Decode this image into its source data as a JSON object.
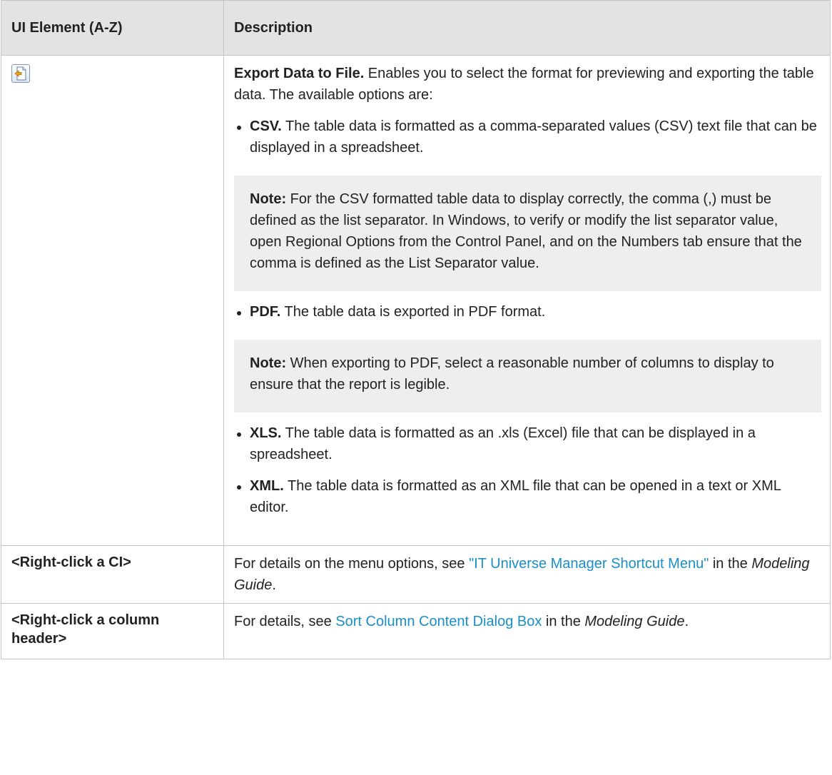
{
  "table": {
    "headers": {
      "element": "UI Element (A-Z)",
      "description": "Description"
    },
    "rows": {
      "export": {
        "icon": "export-data-icon",
        "title": "Export Data to File.",
        "intro": " Enables you to select the format for previewing and exporting the table data. The available options are:",
        "options": {
          "csv": {
            "label": "CSV.",
            "text": " The table data is formatted as a comma-separated values (CSV) text file that can be displayed in a spreadsheet.",
            "note_label": "Note:",
            "note_text": " For the CSV formatted table data to display correctly, the comma (,) must be defined as the list separator. In Windows, to verify or modify the list separator value, open Regional Options from the Control Panel, and on the Numbers tab ensure that the comma is defined as the List Separator value."
          },
          "pdf": {
            "label": "PDF.",
            "text": " The table data is exported in PDF format.",
            "note_label": "Note:",
            "note_text": " When exporting to PDF, select a reasonable number of columns to display to ensure that the report is legible."
          },
          "xls": {
            "label": "XLS.",
            "text": " The table data is formatted as an .xls (Excel) file that can be displayed in a spreadsheet."
          },
          "xml": {
            "label": "XML.",
            "text": " The table data is formatted as an XML file that can be opened in a text or XML editor."
          }
        }
      },
      "right_click_ci": {
        "element": "<Right-click a CI>",
        "desc_prefix": "For details on the menu options, see ",
        "link": "\"IT Universe Manager Shortcut Menu\"",
        "desc_mid": " in the ",
        "guide": "Modeling Guide",
        "desc_suffix": "."
      },
      "right_click_column": {
        "element": "<Right-click a column header>",
        "desc_prefix": "For details, see ",
        "link": "Sort Column Content Dialog Box",
        "desc_mid": " in the ",
        "guide": "Modeling Guide",
        "desc_suffix": "."
      }
    }
  }
}
